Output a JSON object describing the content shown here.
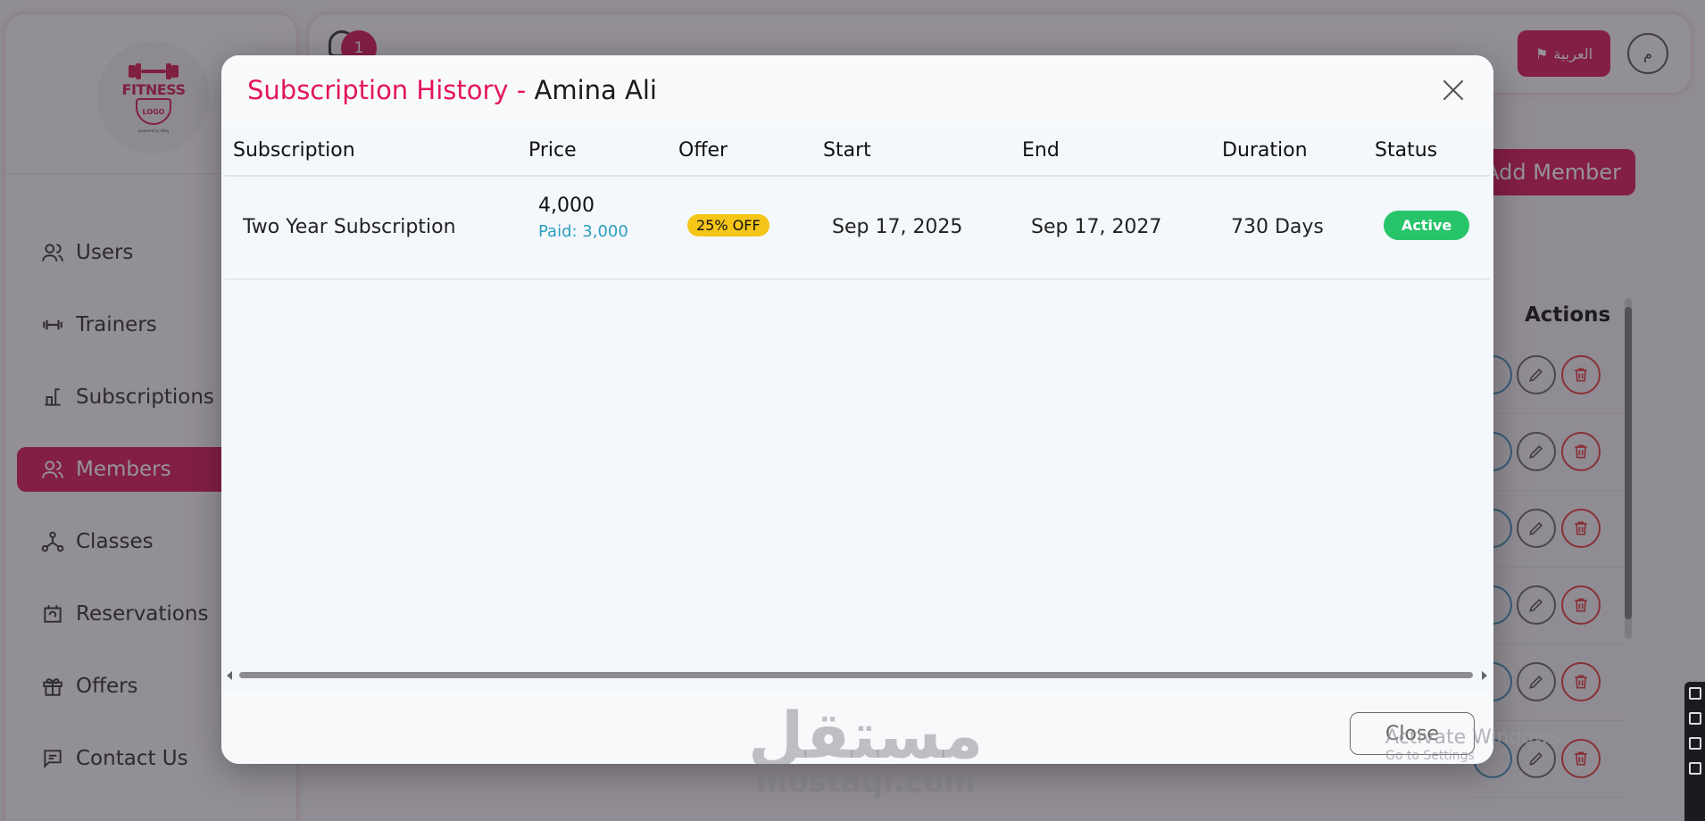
{
  "app": {
    "logo": {
      "text": "FITNESS",
      "shield_text": "LOGO",
      "sub": "powered by Vteq"
    },
    "sidebar": {
      "items": [
        {
          "label": "Users",
          "icon": "users-icon",
          "active": false
        },
        {
          "label": "Trainers",
          "icon": "dumbbell-icon",
          "active": false
        },
        {
          "label": "Subscriptions",
          "icon": "scale-icon",
          "active": false
        },
        {
          "label": "Members",
          "icon": "members-icon",
          "active": true
        },
        {
          "label": "Classes",
          "icon": "network-icon",
          "active": false
        },
        {
          "label": "Reservations",
          "icon": "calendar-refresh-icon",
          "active": false
        },
        {
          "label": "Offers",
          "icon": "gift-icon",
          "active": false
        },
        {
          "label": "Contact Us",
          "icon": "message-icon",
          "active": false
        }
      ]
    },
    "topbar": {
      "notification_count": "1",
      "language_label": "العربية",
      "user_initial": "م"
    },
    "add_member_label": "Add Member",
    "actions_header": "Actions"
  },
  "modal": {
    "title_prefix": "Subscription History -",
    "title_name": "Amina Ali",
    "columns": [
      "Subscription",
      "Price",
      "Offer",
      "Start",
      "End",
      "Duration",
      "Status"
    ],
    "rows": [
      {
        "subscription": "Two Year Subscription",
        "price": "4,000",
        "paid": "Paid: 3,000",
        "offer": "25% OFF",
        "start": "Sep 17, 2025",
        "end": "Sep 17, 2027",
        "duration": "730 Days",
        "status": "Active"
      }
    ],
    "close_label": "Close"
  },
  "overlay": {
    "watermark_ar": "مستقل",
    "watermark_en": "mostaql.com",
    "activate_title": "Activate Windows",
    "activate_sub": "Go to Settings"
  },
  "colors": {
    "accent": "#d9145a",
    "title_pink": "#e3155d",
    "paid_blue": "#2a9fbf",
    "offer_yellow": "#f5c518",
    "status_green": "#27c46a"
  }
}
